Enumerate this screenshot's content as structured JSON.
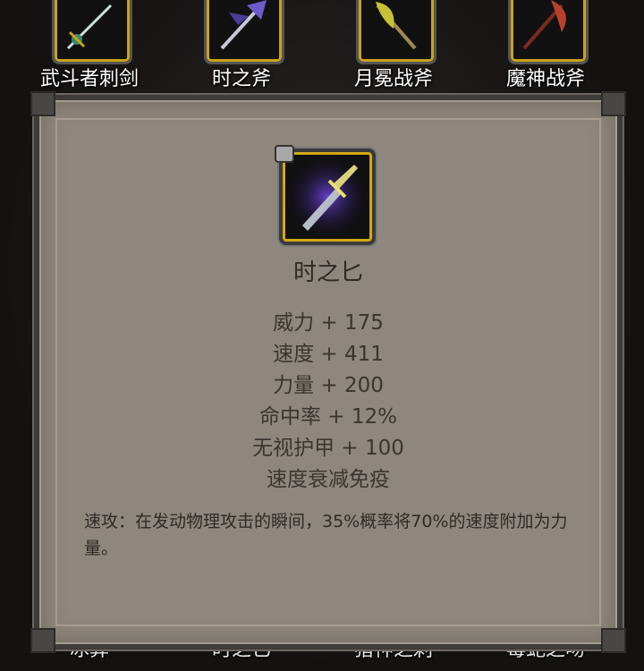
{
  "top_row": [
    {
      "label": "武斗者刺剑",
      "locked": false
    },
    {
      "label": "时之斧",
      "locked": true
    },
    {
      "label": "月冕战斧",
      "locked": true
    },
    {
      "label": "魔神战斧",
      "locked": true
    }
  ],
  "bottom_row": [
    "冰葬",
    "时之匕",
    "猎神之刺",
    "毒蛇之吻"
  ],
  "item": {
    "name": "时之匕",
    "locked": true,
    "stats": [
      "威力 + 175",
      "速度 + 411",
      "力量 + 200",
      "命中率 + 12%",
      "无视护甲 + 100",
      "速度衰减免疫"
    ],
    "description": "速攻：在发动物理攻击的瞬间，35%概率将70%的速度附加为力量。"
  },
  "colors": {
    "panel": "#8e877d",
    "frame_gold": "#d4a814",
    "text": "#3a3530"
  }
}
